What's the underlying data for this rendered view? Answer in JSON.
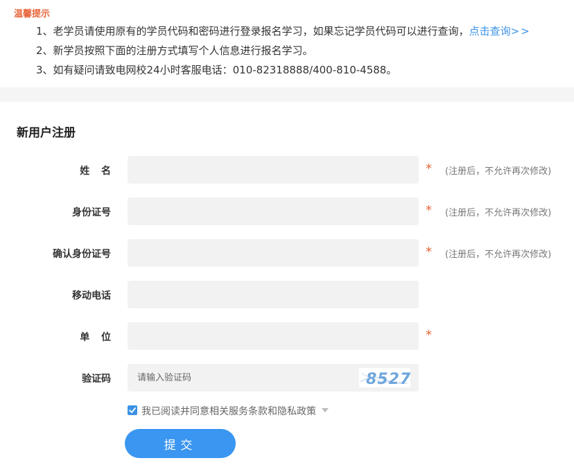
{
  "notice": {
    "title": "温馨提示",
    "line1_text": "1、老学员请使用原有的学员代码和密码进行登录报名学习，如果忘记学员代码可以进行查询，",
    "line1_link": "点击查询",
    "line1_link_arrow": ">>",
    "line2": "2、新学员按照下面的注册方式填写个人信息进行报名学习。",
    "line3": "3、如有疑问请致电网校24小时客服电话：010-82318888/400-810-4588。"
  },
  "form": {
    "title": "新用户注册",
    "required_mark": "*",
    "fields": {
      "name": {
        "label": "姓名",
        "value": "",
        "required": true,
        "hint": "(注册后，不允许再次修改)"
      },
      "id_number": {
        "label": "身份证号",
        "value": "",
        "required": true,
        "hint": "(注册后，不允许再次修改)"
      },
      "confirm_id": {
        "label": "确认身份证号",
        "value": "",
        "required": true,
        "hint": "(注册后，不允许再次修改)"
      },
      "mobile": {
        "label": "移动电话",
        "value": "",
        "required": false
      },
      "company": {
        "label": "单位",
        "value": "",
        "required": true
      },
      "captcha": {
        "label": "验证码",
        "value": "",
        "placeholder": "请输入验证码",
        "image_text": "8527"
      }
    },
    "agree": {
      "checked": true,
      "text": "我已阅读并同意相关服务条款和隐私政策"
    },
    "submit_label": "提交"
  },
  "colors": {
    "accent": "#3a92e6",
    "button": "#3a96f0",
    "warning": "#e8653a",
    "field_bg": "#f2f2f2"
  }
}
